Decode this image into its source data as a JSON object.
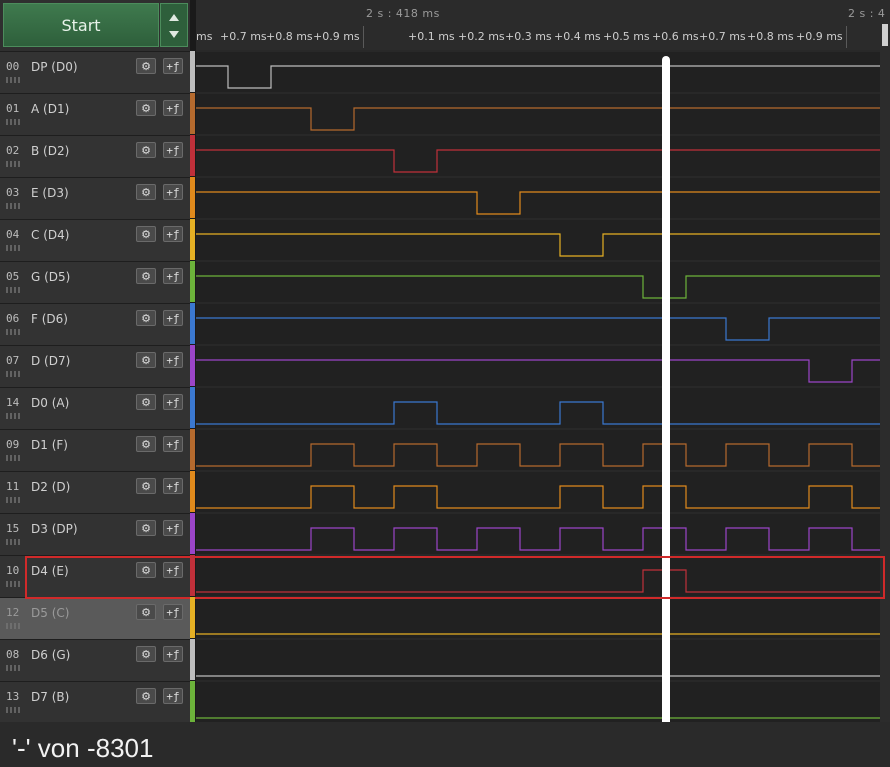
{
  "toolbar": {
    "start_label": "Start"
  },
  "ruler": {
    "top_label_1": "2 s : 418 ms",
    "top_label_2": "2 s : 4",
    "ticks": [
      "ms",
      "+0.7 ms",
      "+0.8 ms",
      "+0.9 ms",
      "+0.1 ms",
      "+0.2 ms",
      "+0.3 ms",
      "+0.4 ms",
      "+0.5 ms",
      "+0.6 ms",
      "+0.7 ms",
      "+0.8 ms",
      "+0.9 ms"
    ]
  },
  "channels": [
    {
      "num": "00",
      "name": "DP (D0)",
      "color": "#bdbdbd"
    },
    {
      "num": "01",
      "name": "A (D1)",
      "color": "#b56a2e"
    },
    {
      "num": "02",
      "name": "B (D2)",
      "color": "#c0303a"
    },
    {
      "num": "03",
      "name": "E (D3)",
      "color": "#e08a1c"
    },
    {
      "num": "04",
      "name": "C (D4)",
      "color": "#e5b024"
    },
    {
      "num": "05",
      "name": "G (D5)",
      "color": "#6cb33a"
    },
    {
      "num": "06",
      "name": "F (D6)",
      "color": "#3b78d0"
    },
    {
      "num": "07",
      "name": "D (D7)",
      "color": "#9b45c8"
    },
    {
      "num": "14",
      "name": "D0 (A)",
      "color": "#3b78d0"
    },
    {
      "num": "09",
      "name": "D1 (F)",
      "color": "#b56a2e"
    },
    {
      "num": "11",
      "name": "D2 (D)",
      "color": "#e08a1c"
    },
    {
      "num": "15",
      "name": "D3 (DP)",
      "color": "#9b45c8"
    },
    {
      "num": "10",
      "name": "D4 (E)",
      "color": "#c0303a"
    },
    {
      "num": "12",
      "name": "D5 (C)",
      "color": "#e5b024"
    },
    {
      "num": "08",
      "name": "D6 (G)",
      "color": "#bdbdbd"
    },
    {
      "num": "13",
      "name": "D7 (B)",
      "color": "#6cb33a"
    }
  ],
  "buttons": {
    "settings_glyph": "⚙",
    "trigger_glyph": "+ƒ"
  },
  "footer": {
    "text": "'-' von -8301"
  }
}
